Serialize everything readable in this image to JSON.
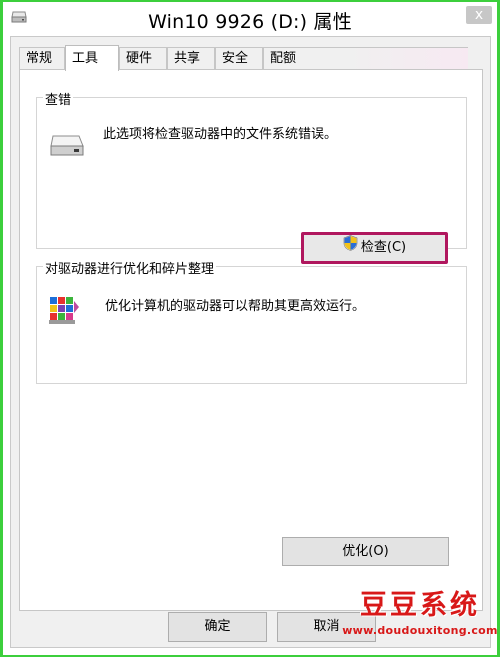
{
  "window": {
    "title": "Win10 9926 (D:) 属性",
    "close_label": "x"
  },
  "tabs": [
    {
      "label": "常规",
      "active": false
    },
    {
      "label": "工具",
      "active": true
    },
    {
      "label": "硬件",
      "active": false
    },
    {
      "label": "共享",
      "active": false
    },
    {
      "label": "安全",
      "active": false
    },
    {
      "label": "配额",
      "active": false
    }
  ],
  "error_check": {
    "group_title": "查错",
    "description": "此选项将检查驱动器中的文件系统错误。",
    "button_label": "检查(C)"
  },
  "optimize": {
    "group_title": "对驱动器进行优化和碎片整理",
    "description": "优化计算机的驱动器可以帮助其更高效运行。",
    "button_label": "优化(O)"
  },
  "footer": {
    "ok_label": "确定",
    "cancel_label": "取消"
  },
  "watermark": {
    "title": "豆豆系统",
    "url": "www.doudouxitong.com"
  },
  "colors": {
    "highlight_border": "#b0175e",
    "background_frame": "#3ccf3c",
    "watermark": "#d81818"
  }
}
